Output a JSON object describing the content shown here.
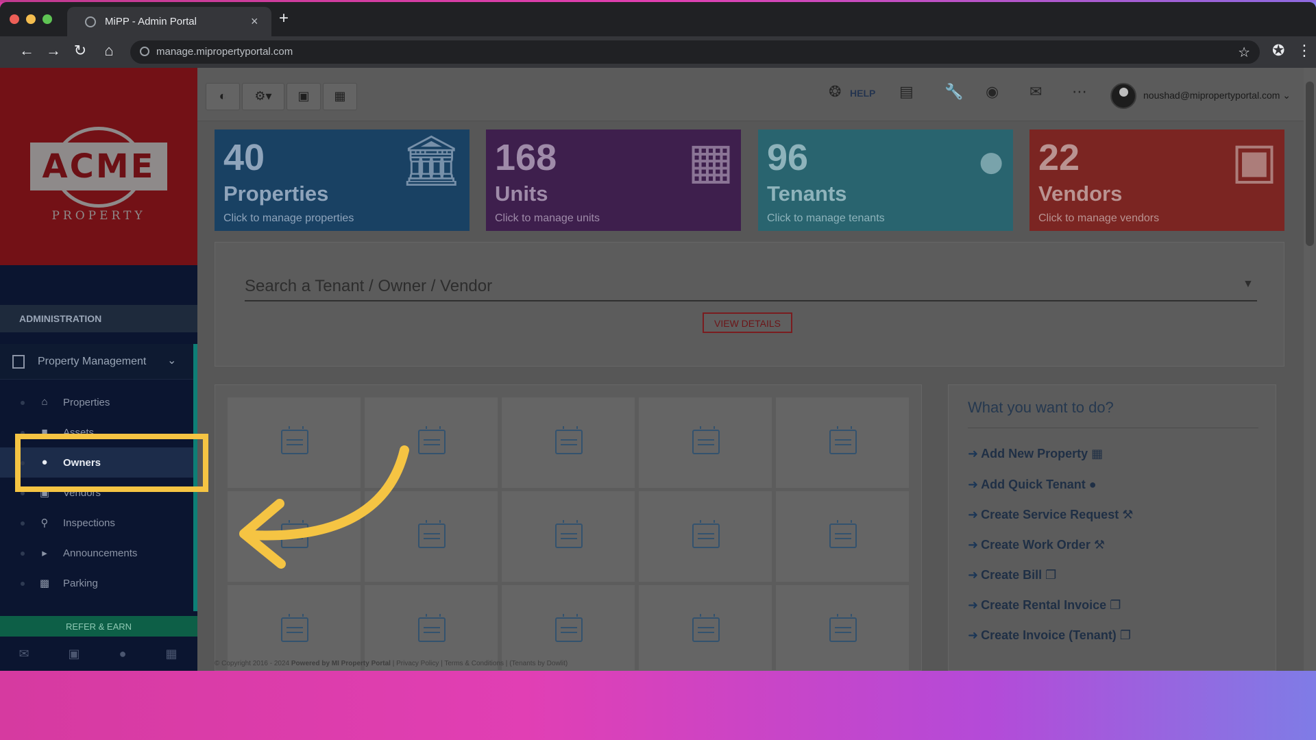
{
  "browser": {
    "tab_title": "MiPP - Admin Portal",
    "tab_close": "×",
    "new_tab": "+",
    "url": "manage.mipropertyportal.com",
    "nav_icons": [
      "back-icon",
      "forward-icon",
      "reload-icon",
      "home-icon"
    ]
  },
  "sidebar": {
    "logo_text": "ACME",
    "logo_sub": "PROPERTY",
    "admin_header": "ADMINISTRATION",
    "group_label": "Property Management",
    "items": [
      {
        "label": "Properties",
        "icon": "home-icon"
      },
      {
        "label": "Assets",
        "icon": "box-icon"
      },
      {
        "label": "Owners",
        "icon": "user-icon"
      },
      {
        "label": "Vendors",
        "icon": "briefcase-icon"
      },
      {
        "label": "Inspections",
        "icon": "search-icon"
      },
      {
        "label": "Announcements",
        "icon": "megaphone-icon"
      },
      {
        "label": "Parking",
        "icon": "car-icon"
      }
    ],
    "refer": "REFER & EARN"
  },
  "topnav": {
    "help": "HELP",
    "user_email": "noushad@mipropertyportal.com"
  },
  "cards": [
    {
      "num": "40",
      "title": "Properties",
      "sub": "Click to manage properties",
      "icon": "bank-icon",
      "color": "#194163"
    },
    {
      "num": "168",
      "title": "Units",
      "sub": "Click to manage units",
      "icon": "building-icon",
      "color": "#3e1f4d"
    },
    {
      "num": "96",
      "title": "Tenants",
      "sub": "Click to manage tenants",
      "icon": "users-icon",
      "color": "#29646f"
    },
    {
      "num": "22",
      "title": "Vendors",
      "sub": "Click to manage vendors",
      "icon": "briefcase-icon",
      "color": "#7b2522"
    }
  ],
  "search": {
    "placeholder": "Search a Tenant / Owner / Vendor",
    "view_details": "VIEW DETAILS"
  },
  "actions": {
    "title": "What you want to do?",
    "items": [
      "Add New Property",
      "Add Quick Tenant",
      "Create Service Request",
      "Create Work Order",
      "Create Bill",
      "Create Rental Invoice",
      "Create Invoice (Tenant)"
    ]
  },
  "footer": {
    "copyright": "© Copyright 2016 - 2024",
    "powered": "Powered by MI Property Portal",
    "privacy": "Privacy Policy",
    "terms": "Terms & Conditions",
    "tenants": "(Tenants by Dowlit)"
  },
  "overlay": {
    "highlight_color": "#f5c443"
  }
}
